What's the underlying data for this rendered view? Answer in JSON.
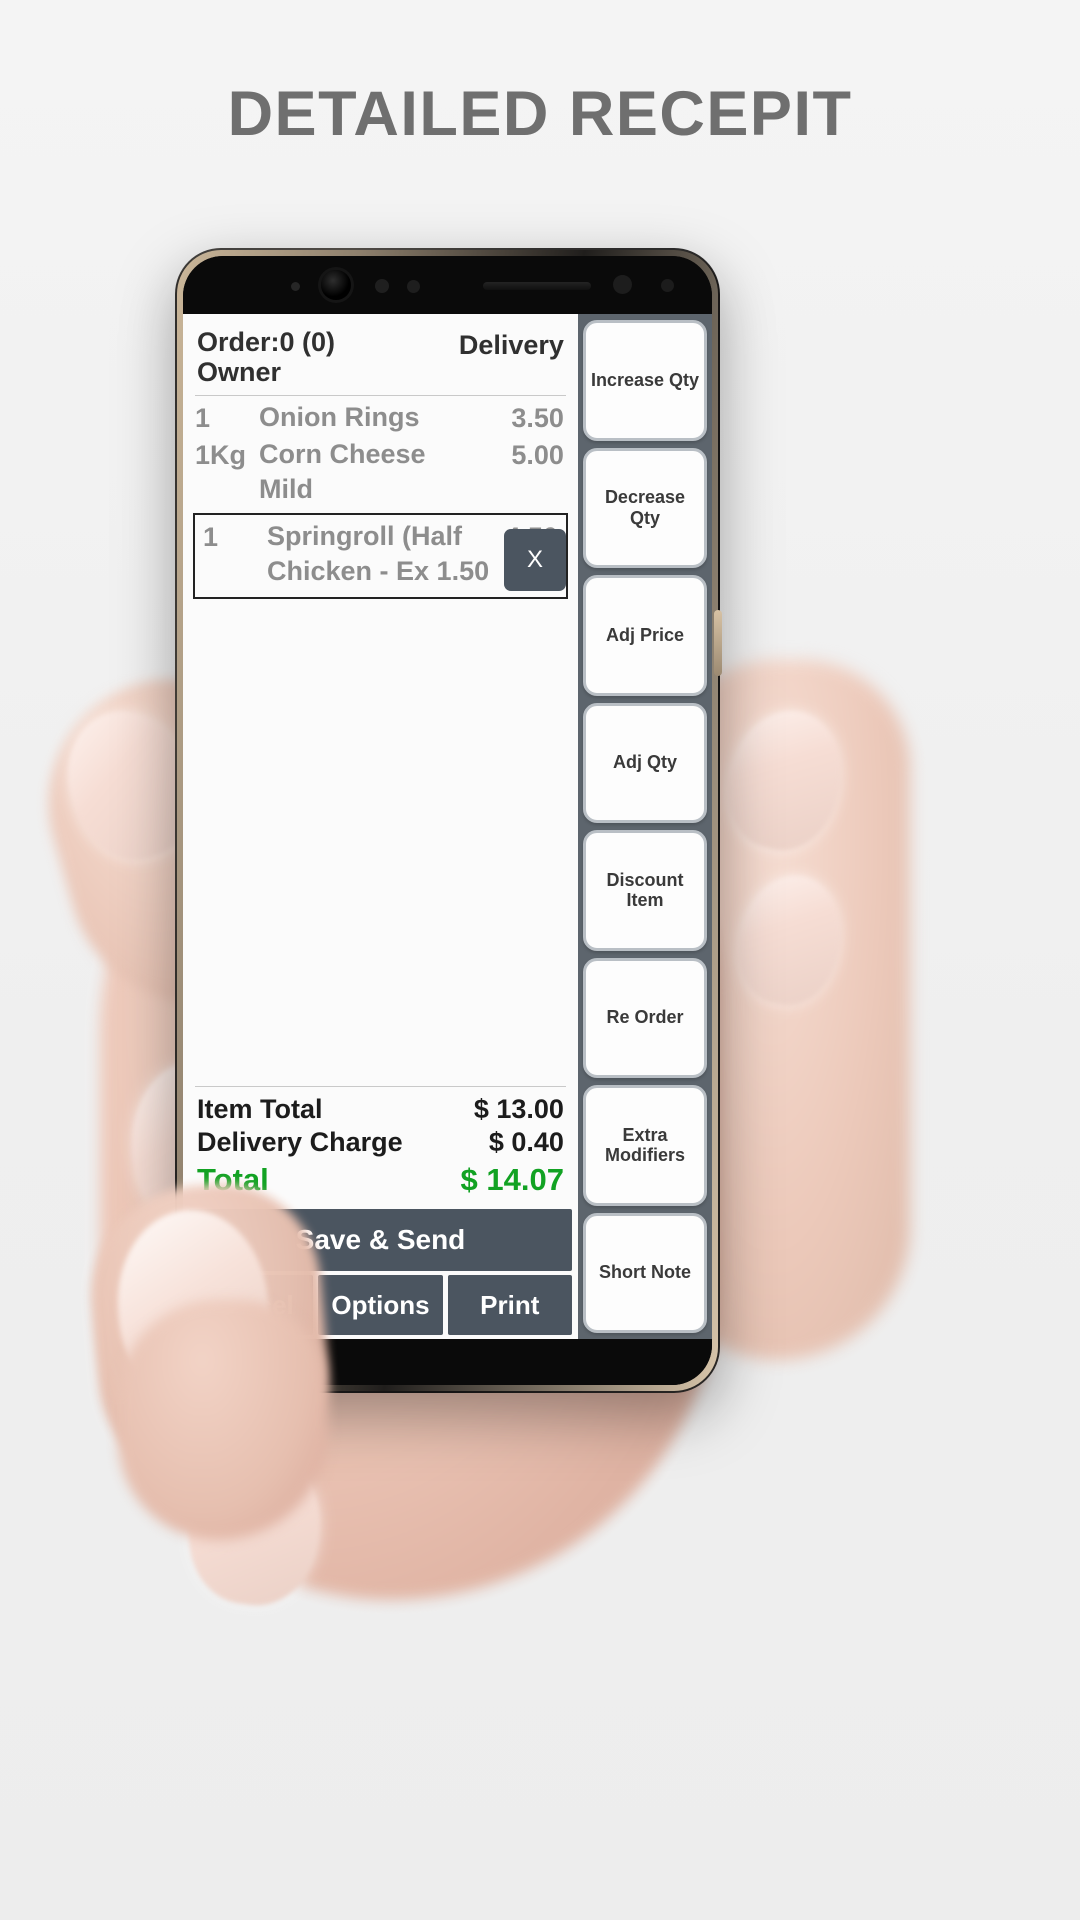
{
  "banner": {
    "title": "DETAILED RECEPIT"
  },
  "receipt": {
    "order_label": "Order:0 (0)",
    "owner_label": "Owner",
    "mode_label": "Delivery",
    "items": [
      {
        "qty": "1",
        "name": "Onion Rings",
        "price": "3.50",
        "sub": ""
      },
      {
        "qty": "1Kg",
        "name": "Corn Cheese",
        "price": "5.00",
        "sub": "Mild"
      }
    ],
    "selected_item": {
      "qty": "1",
      "name": "Springroll (Half",
      "price": "4.50",
      "sub": "Chicken - Ex 1.50",
      "remove_label": "X"
    },
    "totals": [
      {
        "label": "Item Total",
        "value": "$ 13.00"
      },
      {
        "label": "Delivery Charge",
        "value": "$ 0.40"
      }
    ],
    "grand_total": {
      "label": "Total",
      "value": "$ 14.07"
    },
    "save_label": "Save & Send",
    "bottom_buttons": [
      {
        "label": "Cancel"
      },
      {
        "label": "Options"
      },
      {
        "label": "Print"
      }
    ]
  },
  "actions": [
    {
      "label": "Increase Qty"
    },
    {
      "label": "Decrease Qty"
    },
    {
      "label": "Adj Price"
    },
    {
      "label": "Adj Qty"
    },
    {
      "label": "Discount Item"
    },
    {
      "label": "Re Order"
    },
    {
      "label": "Extra Modifiers"
    },
    {
      "label": "Short Note"
    }
  ],
  "colors": {
    "accent_dark": "#4b5560",
    "panel": "#5d656d",
    "total_green": "#12a223",
    "title_gray": "#6f6f6f",
    "item_gray": "#8d8d8d"
  }
}
